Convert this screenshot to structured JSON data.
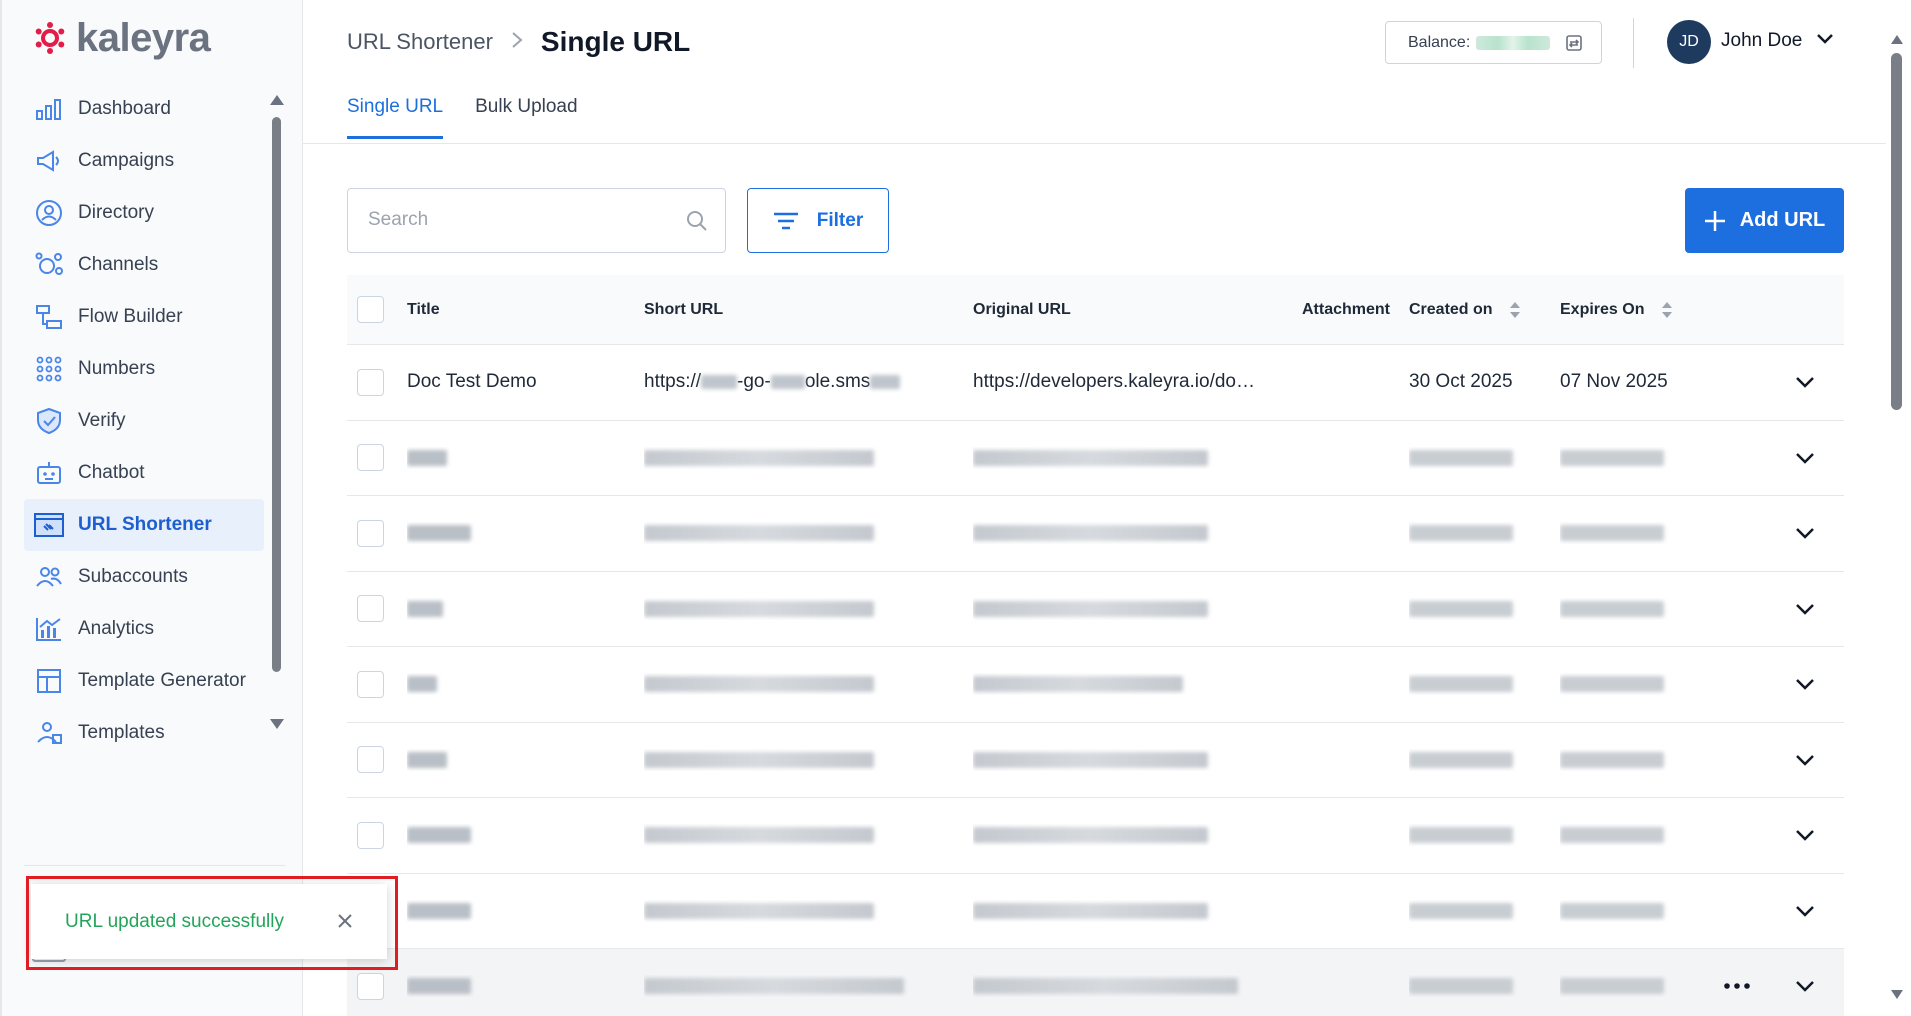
{
  "brand": {
    "name": "kaleyra",
    "accent": "#1d6fe0",
    "logo_color": "#e11d48"
  },
  "sidebar": {
    "items": [
      {
        "label": "Dashboard",
        "icon": "bar-chart-icon"
      },
      {
        "label": "Campaigns",
        "icon": "megaphone-icon"
      },
      {
        "label": "Directory",
        "icon": "contact-icon"
      },
      {
        "label": "Channels",
        "icon": "channels-icon"
      },
      {
        "label": "Flow Builder",
        "icon": "flow-icon"
      },
      {
        "label": "Numbers",
        "icon": "dial-grid-icon"
      },
      {
        "label": "Verify",
        "icon": "shield-check-icon"
      },
      {
        "label": "Chatbot",
        "icon": "robot-icon"
      },
      {
        "label": "URL Shortener",
        "icon": "link-icon",
        "active": true
      },
      {
        "label": "Subaccounts",
        "icon": "users-icon"
      },
      {
        "label": "Analytics",
        "icon": "analytics-icon"
      },
      {
        "label": "Template Generator",
        "icon": "template-grid-icon"
      },
      {
        "label": "Templates",
        "icon": "templates-icon"
      }
    ]
  },
  "header": {
    "breadcrumb_parent": "URL Shortener",
    "breadcrumb_separator": ">",
    "page_title": "Single URL",
    "balance_label": "Balance:",
    "user_initials": "JD",
    "user_name": "John Doe"
  },
  "tabs": [
    {
      "label": "Single URL",
      "active": true
    },
    {
      "label": "Bulk Upload",
      "active": false
    }
  ],
  "toolbar": {
    "search_placeholder": "Search",
    "filter_label": "Filter",
    "add_label": "Add URL"
  },
  "table": {
    "columns": [
      "Title",
      "Short URL",
      "Original URL",
      "Attachment",
      "Created on",
      "Expires On"
    ],
    "first_row": {
      "title": "Doc Test Demo",
      "short_url_start": "https://",
      "short_url_mid": "-go-",
      "short_url_end": "ole.sms",
      "original_url": "https://developers.kaleyra.io/do…",
      "created_on": "30 Oct 2025",
      "expires_on": "07 Nov 2025"
    },
    "blurred_row_count": 8
  },
  "toast": {
    "message": "URL updated successfully",
    "close_label": "×"
  }
}
